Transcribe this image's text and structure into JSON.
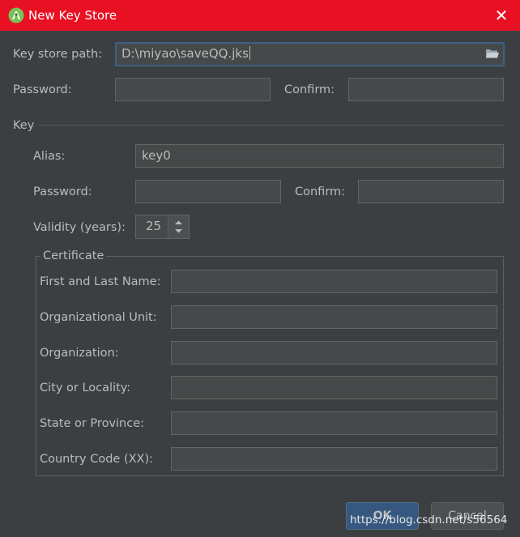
{
  "window": {
    "title": "New Key Store",
    "close_glyph": "✕",
    "accent": "#e81123"
  },
  "keystore": {
    "path_label": "Key store path:",
    "path_value": "D:\\miyao\\saveQQ.jks",
    "password_label": "Password:",
    "confirm_label": "Confirm:",
    "password_value": "",
    "confirm_value": ""
  },
  "key": {
    "section_label": "Key",
    "alias_label": "Alias:",
    "alias_value": "key0",
    "password_label": "Password:",
    "confirm_label": "Confirm:",
    "password_value": "",
    "confirm_value": "",
    "validity_label": "Validity (years):",
    "validity_value": "25"
  },
  "certificate": {
    "title": "Certificate",
    "fields": [
      {
        "label": "First and Last Name:",
        "value": ""
      },
      {
        "label": "Organizational Unit:",
        "value": ""
      },
      {
        "label": "Organization:",
        "value": ""
      },
      {
        "label": "City or Locality:",
        "value": ""
      },
      {
        "label": "State or Province:",
        "value": ""
      },
      {
        "label": "Country Code (XX):",
        "value": ""
      }
    ]
  },
  "buttons": {
    "ok_label": "OK",
    "cancel_label": "Cancel"
  },
  "watermark": "https://blog.csdn.net/s56564",
  "icons": {
    "app": "android-studio-icon",
    "folder": "folder-icon",
    "close": "close-icon",
    "spinner": "spinner-arrows-icon"
  }
}
